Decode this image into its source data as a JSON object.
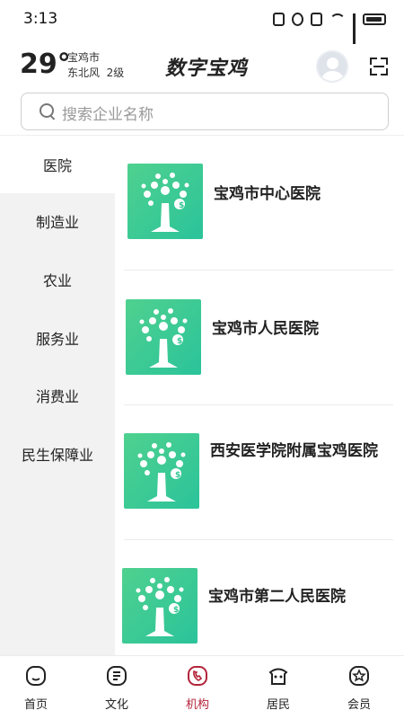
{
  "status_bar": {
    "time": "3:13"
  },
  "weather": {
    "temperature": "29°",
    "city": "宝鸡市",
    "wind": "东北风  2级"
  },
  "app": {
    "brand": "数字宝鸡"
  },
  "search": {
    "placeholder": "搜索企业名称"
  },
  "sidebar": {
    "items": [
      {
        "label": "医院",
        "active": true
      },
      {
        "label": "制造业",
        "active": false
      },
      {
        "label": "农业",
        "active": false
      },
      {
        "label": "服务业",
        "active": false
      },
      {
        "label": "消费业",
        "active": false
      },
      {
        "label": "民生保障业",
        "active": false
      }
    ]
  },
  "list": {
    "items": [
      {
        "title": "宝鸡市中心医院",
        "icon": "money-tree-icon"
      },
      {
        "title": "宝鸡市人民医院",
        "icon": "money-tree-icon"
      },
      {
        "title": "西安医学院附属宝鸡医院",
        "icon": "money-tree-icon"
      },
      {
        "title": "宝鸡市第二人民医院",
        "icon": "money-tree-icon"
      }
    ]
  },
  "bottom_nav": {
    "items": [
      {
        "label": "首页",
        "icon": "home-icon",
        "active": false
      },
      {
        "label": "文化",
        "icon": "culture-icon",
        "active": false
      },
      {
        "label": "机构",
        "icon": "phone-icon",
        "active": true
      },
      {
        "label": "居民",
        "icon": "residents-icon",
        "active": false
      },
      {
        "label": "会员",
        "icon": "member-icon",
        "active": false
      }
    ]
  },
  "colors": {
    "accent": "#b3243a",
    "thumb_green": "#3cca94",
    "sidebar_bg": "#f2f2f2"
  }
}
